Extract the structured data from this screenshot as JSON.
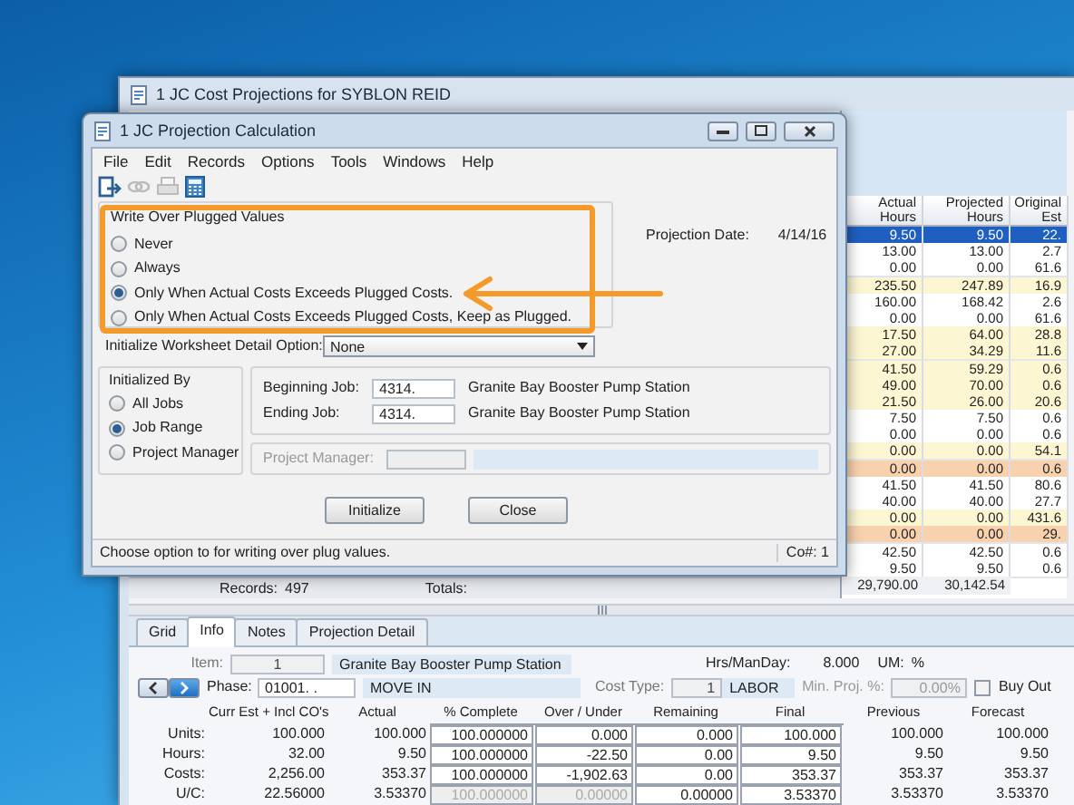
{
  "back_window": {
    "title": "1 JC Cost Projections for SYBLON REID",
    "grid": {
      "columns": [
        "Actual Hours",
        "Projected Hours",
        "Original Est"
      ],
      "rows": [
        {
          "cells": [
            "9.50",
            "9.50",
            "22."
          ],
          "selected": true
        },
        {
          "cells": [
            "13.00",
            "13.00",
            "2.7"
          ],
          "selected": false,
          "color": "#ffffff"
        },
        {
          "cells": [
            "0.00",
            "0.00",
            "61.6"
          ],
          "selected": false,
          "color": "#ffffff"
        },
        {
          "cells": [
            "235.50",
            "247.89",
            "16.9"
          ],
          "selected": false,
          "color": "#fdf6d3"
        },
        {
          "cells": [
            "160.00",
            "168.42",
            "2.6"
          ],
          "selected": false,
          "color": "#ffffff"
        },
        {
          "cells": [
            "0.00",
            "0.00",
            "61.6"
          ],
          "selected": false,
          "color": "#ffffff"
        },
        {
          "cells": [
            "17.50",
            "64.00",
            "28.8"
          ],
          "selected": false,
          "color": "#fdf6d3"
        },
        {
          "cells": [
            "27.00",
            "34.29",
            "11.6"
          ],
          "selected": false,
          "color": "#fdf6d3"
        },
        {
          "cells": [
            "41.50",
            "59.29",
            "0.6"
          ],
          "selected": false,
          "color": "#fdf6d3"
        },
        {
          "cells": [
            "49.00",
            "70.00",
            "0.6"
          ],
          "selected": false,
          "color": "#fdf6d3"
        },
        {
          "cells": [
            "21.50",
            "26.00",
            "20.6"
          ],
          "selected": false,
          "color": "#fdf6d3"
        },
        {
          "cells": [
            "7.50",
            "7.50",
            "0.6"
          ],
          "selected": false,
          "color": "#ffffff"
        },
        {
          "cells": [
            "0.00",
            "0.00",
            "0.6"
          ],
          "selected": false,
          "color": "#ffffff"
        },
        {
          "cells": [
            "0.00",
            "0.00",
            "54.1"
          ],
          "selected": false,
          "color": "#fdf6d3"
        },
        {
          "cells": [
            "0.00",
            "0.00",
            "0.6"
          ],
          "selected": false,
          "color": "#f8d2ae"
        },
        {
          "cells": [
            "41.50",
            "41.50",
            "80.6"
          ],
          "selected": false,
          "color": "#ffffff"
        },
        {
          "cells": [
            "40.00",
            "40.00",
            "27.7"
          ],
          "selected": false,
          "color": "#ffffff"
        },
        {
          "cells": [
            "0.00",
            "0.00",
            "431.6"
          ],
          "selected": false,
          "color": "#fdf6d3"
        },
        {
          "cells": [
            "0.00",
            "0.00",
            "29."
          ],
          "selected": false,
          "color": "#f8d2ae"
        },
        {
          "cells": [
            "42.50",
            "42.50",
            "0.6"
          ],
          "selected": false,
          "color": "#ffffff"
        },
        {
          "cells": [
            "9.50",
            "9.50",
            "0.6"
          ],
          "selected": false,
          "color": "#ffffff"
        }
      ],
      "totals": [
        "29,790.00",
        "30,142.54"
      ]
    },
    "records_label": "Records:",
    "records_count": "497",
    "totals_label": "Totals:",
    "detail": {
      "tabs": [
        {
          "label": "Grid",
          "selected": false
        },
        {
          "label": "Info",
          "selected": true
        },
        {
          "label": "Notes",
          "selected": false
        },
        {
          "label": "Projection Detail",
          "selected": false
        }
      ],
      "item_label": "Item:",
      "item_value": "1",
      "item_name": "Granite Bay Booster Pump Station",
      "hrs_label": "Hrs/ManDay:",
      "hrs_value": "8.000",
      "um_label": "UM:",
      "um_value": "%",
      "phase_label": "Phase:",
      "phase_value": "01001. .",
      "phase_name": "MOVE IN",
      "cost_type_label": "Cost Type:",
      "cost_type_value": "1",
      "cost_type_name": "LABOR",
      "min_proj_label": "Min. Proj. %:",
      "min_proj_value": "0.00%",
      "buy_out": {
        "label": "Buy Out",
        "checked": false
      },
      "table": {
        "columns": [
          {
            "label": "Curr Est + Incl CO's",
            "boxed": false
          },
          {
            "label": "Actual",
            "boxed": false
          },
          {
            "label": "% Complete",
            "boxed": true
          },
          {
            "label": "Over / Under",
            "boxed": true
          },
          {
            "label": "Remaining",
            "boxed": true
          },
          {
            "label": "Final",
            "boxed": true
          },
          {
            "label": "Previous",
            "boxed": false
          },
          {
            "label": "Forecast",
            "boxed": false
          }
        ],
        "rows": [
          {
            "label": "Units:",
            "cells": [
              {
                "text": "100.000",
                "disabled": false
              },
              {
                "text": "100.000",
                "disabled": false
              },
              {
                "text": "100.000000",
                "disabled": false
              },
              {
                "text": "0.000",
                "disabled": false
              },
              {
                "text": "0.000",
                "disabled": false
              },
              {
                "text": "100.000",
                "disabled": false
              },
              {
                "text": "100.000",
                "disabled": false
              },
              {
                "text": "100.000",
                "disabled": false
              }
            ]
          },
          {
            "label": "Hours:",
            "cells": [
              {
                "text": "32.00",
                "disabled": false
              },
              {
                "text": "9.50",
                "disabled": false
              },
              {
                "text": "100.000000",
                "disabled": false
              },
              {
                "text": "-22.50",
                "disabled": false
              },
              {
                "text": "0.00",
                "disabled": false
              },
              {
                "text": "9.50",
                "disabled": false
              },
              {
                "text": "9.50",
                "disabled": false
              },
              {
                "text": "9.50",
                "disabled": false
              }
            ]
          },
          {
            "label": "Costs:",
            "cells": [
              {
                "text": "2,256.00",
                "disabled": false
              },
              {
                "text": "353.37",
                "disabled": false
              },
              {
                "text": "100.000000",
                "disabled": false
              },
              {
                "text": "-1,902.63",
                "disabled": false
              },
              {
                "text": "0.00",
                "disabled": false
              },
              {
                "text": "353.37",
                "disabled": false
              },
              {
                "text": "353.37",
                "disabled": false
              },
              {
                "text": "353.37",
                "disabled": false
              }
            ]
          },
          {
            "label": "U/C:",
            "cells": [
              {
                "text": "22.56000",
                "disabled": false
              },
              {
                "text": "3.53370",
                "disabled": false
              },
              {
                "text": "100.000000",
                "disabled": true
              },
              {
                "text": "0.00000",
                "disabled": true
              },
              {
                "text": "0.00000",
                "disabled": false
              },
              {
                "text": "3.53370",
                "disabled": false
              },
              {
                "text": "3.53370",
                "disabled": false
              },
              {
                "text": "3.53370",
                "disabled": false
              }
            ]
          }
        ]
      }
    }
  },
  "dialog": {
    "title": "1 JC Projection Calculation",
    "menu": [
      "File",
      "Edit",
      "Records",
      "Options",
      "Tools",
      "Windows",
      "Help"
    ],
    "toolbar": [
      {
        "kind": "exit",
        "disabled": false
      },
      {
        "kind": "link",
        "disabled": true
      },
      {
        "kind": "print",
        "disabled": true
      },
      {
        "kind": "calculator",
        "disabled": false
      }
    ],
    "write_over": {
      "title": "Write Over Plugged Values",
      "options": [
        {
          "label": "Never",
          "selected": false
        },
        {
          "label": "Always",
          "selected": false
        },
        {
          "label": "Only When Actual Costs Exceeds Plugged Costs.",
          "selected": true
        },
        {
          "label": "Only When Actual Costs Exceeds Plugged Costs, Keep as Plugged.",
          "selected": false
        }
      ]
    },
    "projection_date_label": "Projection Date:",
    "projection_date": "4/14/16",
    "detail_option_label": "Initialize Worksheet Detail Option:",
    "detail_option_value": "None",
    "initialized_by": {
      "title": "Initialized By",
      "options": [
        {
          "label": "All Jobs",
          "selected": false
        },
        {
          "label": "Job Range",
          "selected": true
        },
        {
          "label": "Project Manager",
          "selected": false
        }
      ]
    },
    "jobs": [
      {
        "label": "Beginning Job:",
        "value": "4314.",
        "name": "Granite Bay Booster Pump Station"
      },
      {
        "label": "Ending Job:",
        "value": "4314.",
        "name": "Granite Bay Booster Pump Station"
      }
    ],
    "project_manager": {
      "label": "Project Manager:",
      "disabled": true
    },
    "buttons": [
      "Initialize",
      "Close"
    ],
    "status_text": "Choose option to for writing over plug values.",
    "company": "Co#: 1"
  }
}
